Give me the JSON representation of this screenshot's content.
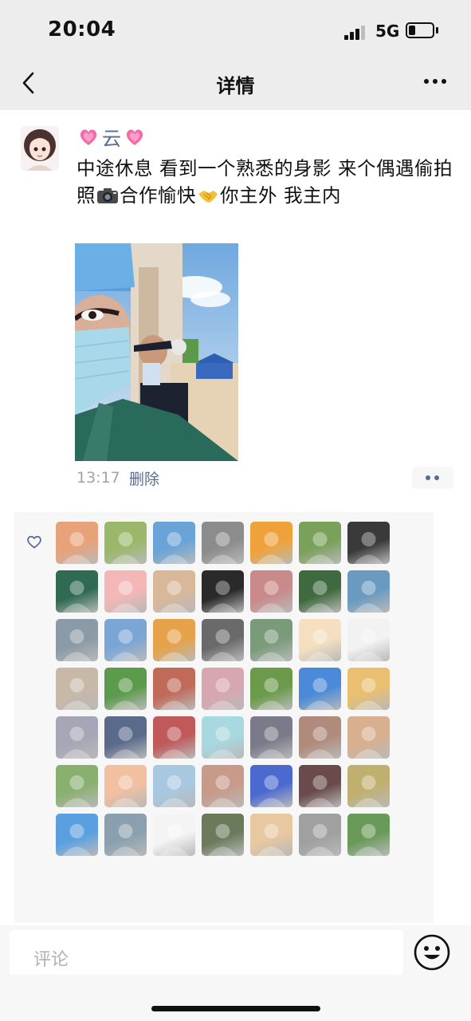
{
  "status_bar": {
    "time": "20:04",
    "network": "5G"
  },
  "nav": {
    "title": "详情",
    "back_icon": "chevron-left-icon",
    "more_icon": "more-dots-icon"
  },
  "post": {
    "author": "云",
    "author_decoration_icon": "pink-heart-emoji",
    "text_parts": [
      "中途休息  看到一个熟悉的身影  来个偶遇偷拍照",
      "合作愉快",
      "你主外   我主内"
    ],
    "emoji_icons": [
      "camera-emoji",
      "handshake-emoji"
    ],
    "time": "13:17",
    "delete_label": "删除",
    "action_icon": "two-dots-icon"
  },
  "likes": {
    "heart_icon": "heart-outline-icon",
    "avatar_count": 49,
    "avatar_colors": [
      "#e8a27a",
      "#9bb86a",
      "#6aa3d8",
      "#8c8c8c",
      "#f0a23a",
      "#7aa05a",
      "#3a3a3a",
      "#2f6a52",
      "#f3b7b7",
      "#d9b89a",
      "#2a2a2a",
      "#c88a8a",
      "#3f6a3f",
      "#6a9ac0",
      "#8a9aa6",
      "#7aa6d6",
      "#e6a24a",
      "#6a6a6a",
      "#7a9a7a",
      "#f4e0c0",
      "#f2f2f2",
      "#c8b8a8",
      "#5c9a4c",
      "#c06a5a",
      "#d8a6b0",
      "#6a9a4a",
      "#4a8ad8",
      "#e8c070",
      "#a6a6b6",
      "#5a6a8a",
      "#c05a5a",
      "#a8d8e0",
      "#7a7a8a",
      "#b08a7a",
      "#d8b090",
      "#8ab070",
      "#f0c0a0",
      "#a8c8e0",
      "#c89a8a",
      "#4a6ad0",
      "#6a4a4a",
      "#c0b070",
      "#5aa0e0",
      "#8aa0b0",
      "#f4f4f4",
      "#6a7a5a",
      "#e8c8a0",
      "#a0a0a0",
      "#6a9a5a"
    ]
  },
  "comment": {
    "placeholder": "评论",
    "emoji_icon": "smiley-face-icon"
  }
}
